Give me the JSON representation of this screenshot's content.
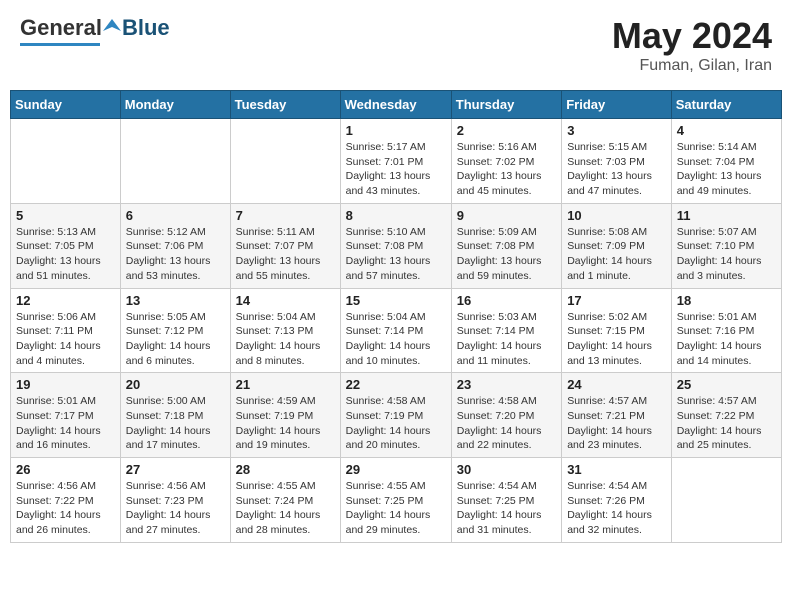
{
  "header": {
    "logo_general": "General",
    "logo_blue": "Blue",
    "month_title": "May 2024",
    "location": "Fuman, Gilan, Iran"
  },
  "days_of_week": [
    "Sunday",
    "Monday",
    "Tuesday",
    "Wednesday",
    "Thursday",
    "Friday",
    "Saturday"
  ],
  "weeks": [
    [
      {
        "day": "",
        "info": ""
      },
      {
        "day": "",
        "info": ""
      },
      {
        "day": "",
        "info": ""
      },
      {
        "day": "1",
        "info": "Sunrise: 5:17 AM\nSunset: 7:01 PM\nDaylight: 13 hours\nand 43 minutes."
      },
      {
        "day": "2",
        "info": "Sunrise: 5:16 AM\nSunset: 7:02 PM\nDaylight: 13 hours\nand 45 minutes."
      },
      {
        "day": "3",
        "info": "Sunrise: 5:15 AM\nSunset: 7:03 PM\nDaylight: 13 hours\nand 47 minutes."
      },
      {
        "day": "4",
        "info": "Sunrise: 5:14 AM\nSunset: 7:04 PM\nDaylight: 13 hours\nand 49 minutes."
      }
    ],
    [
      {
        "day": "5",
        "info": "Sunrise: 5:13 AM\nSunset: 7:05 PM\nDaylight: 13 hours\nand 51 minutes."
      },
      {
        "day": "6",
        "info": "Sunrise: 5:12 AM\nSunset: 7:06 PM\nDaylight: 13 hours\nand 53 minutes."
      },
      {
        "day": "7",
        "info": "Sunrise: 5:11 AM\nSunset: 7:07 PM\nDaylight: 13 hours\nand 55 minutes."
      },
      {
        "day": "8",
        "info": "Sunrise: 5:10 AM\nSunset: 7:08 PM\nDaylight: 13 hours\nand 57 minutes."
      },
      {
        "day": "9",
        "info": "Sunrise: 5:09 AM\nSunset: 7:08 PM\nDaylight: 13 hours\nand 59 minutes."
      },
      {
        "day": "10",
        "info": "Sunrise: 5:08 AM\nSunset: 7:09 PM\nDaylight: 14 hours\nand 1 minute."
      },
      {
        "day": "11",
        "info": "Sunrise: 5:07 AM\nSunset: 7:10 PM\nDaylight: 14 hours\nand 3 minutes."
      }
    ],
    [
      {
        "day": "12",
        "info": "Sunrise: 5:06 AM\nSunset: 7:11 PM\nDaylight: 14 hours\nand 4 minutes."
      },
      {
        "day": "13",
        "info": "Sunrise: 5:05 AM\nSunset: 7:12 PM\nDaylight: 14 hours\nand 6 minutes."
      },
      {
        "day": "14",
        "info": "Sunrise: 5:04 AM\nSunset: 7:13 PM\nDaylight: 14 hours\nand 8 minutes."
      },
      {
        "day": "15",
        "info": "Sunrise: 5:04 AM\nSunset: 7:14 PM\nDaylight: 14 hours\nand 10 minutes."
      },
      {
        "day": "16",
        "info": "Sunrise: 5:03 AM\nSunset: 7:14 PM\nDaylight: 14 hours\nand 11 minutes."
      },
      {
        "day": "17",
        "info": "Sunrise: 5:02 AM\nSunset: 7:15 PM\nDaylight: 14 hours\nand 13 minutes."
      },
      {
        "day": "18",
        "info": "Sunrise: 5:01 AM\nSunset: 7:16 PM\nDaylight: 14 hours\nand 14 minutes."
      }
    ],
    [
      {
        "day": "19",
        "info": "Sunrise: 5:01 AM\nSunset: 7:17 PM\nDaylight: 14 hours\nand 16 minutes."
      },
      {
        "day": "20",
        "info": "Sunrise: 5:00 AM\nSunset: 7:18 PM\nDaylight: 14 hours\nand 17 minutes."
      },
      {
        "day": "21",
        "info": "Sunrise: 4:59 AM\nSunset: 7:19 PM\nDaylight: 14 hours\nand 19 minutes."
      },
      {
        "day": "22",
        "info": "Sunrise: 4:58 AM\nSunset: 7:19 PM\nDaylight: 14 hours\nand 20 minutes."
      },
      {
        "day": "23",
        "info": "Sunrise: 4:58 AM\nSunset: 7:20 PM\nDaylight: 14 hours\nand 22 minutes."
      },
      {
        "day": "24",
        "info": "Sunrise: 4:57 AM\nSunset: 7:21 PM\nDaylight: 14 hours\nand 23 minutes."
      },
      {
        "day": "25",
        "info": "Sunrise: 4:57 AM\nSunset: 7:22 PM\nDaylight: 14 hours\nand 25 minutes."
      }
    ],
    [
      {
        "day": "26",
        "info": "Sunrise: 4:56 AM\nSunset: 7:22 PM\nDaylight: 14 hours\nand 26 minutes."
      },
      {
        "day": "27",
        "info": "Sunrise: 4:56 AM\nSunset: 7:23 PM\nDaylight: 14 hours\nand 27 minutes."
      },
      {
        "day": "28",
        "info": "Sunrise: 4:55 AM\nSunset: 7:24 PM\nDaylight: 14 hours\nand 28 minutes."
      },
      {
        "day": "29",
        "info": "Sunrise: 4:55 AM\nSunset: 7:25 PM\nDaylight: 14 hours\nand 29 minutes."
      },
      {
        "day": "30",
        "info": "Sunrise: 4:54 AM\nSunset: 7:25 PM\nDaylight: 14 hours\nand 31 minutes."
      },
      {
        "day": "31",
        "info": "Sunrise: 4:54 AM\nSunset: 7:26 PM\nDaylight: 14 hours\nand 32 minutes."
      },
      {
        "day": "",
        "info": ""
      }
    ]
  ]
}
